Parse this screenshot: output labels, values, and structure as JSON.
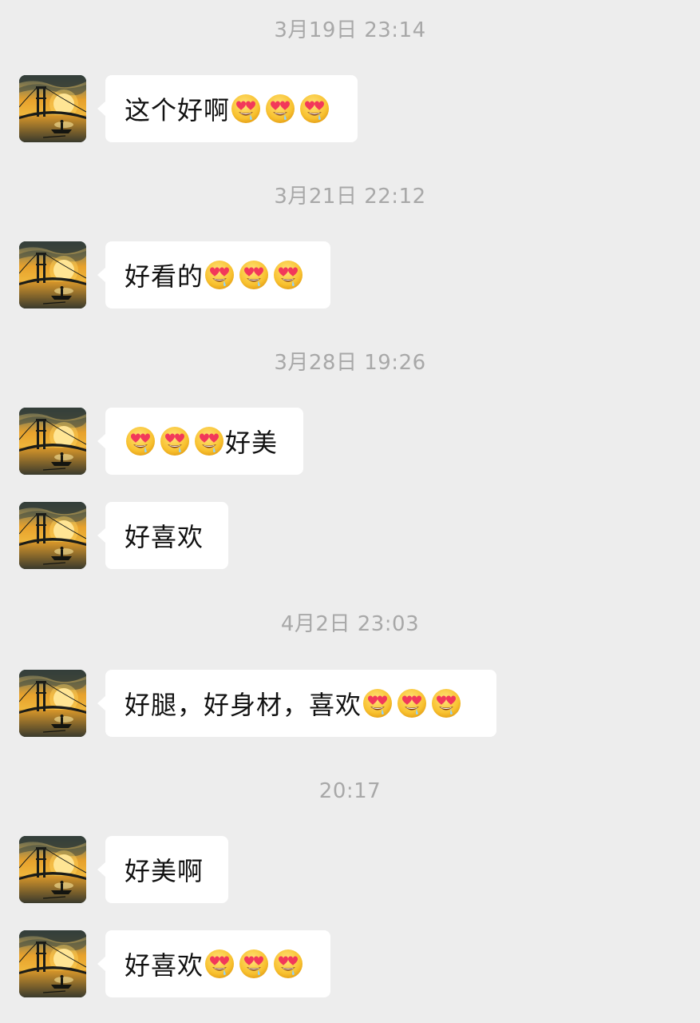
{
  "icons": {
    "avatar": "sunset-bridge-avatar",
    "emoji": "heart-eyes-drooling-emoji"
  },
  "colors": {
    "background": "#ededed",
    "bubble": "#ffffff",
    "timestamp": "#a8a8a8"
  },
  "messages": [
    {
      "timestamp": "3月19日 23:14",
      "text_before": "这个好啊",
      "text_after": "",
      "emoji_before": 0,
      "emoji_after": 3
    },
    {
      "timestamp": "3月21日 22:12",
      "text_before": "好看的",
      "text_after": "",
      "emoji_before": 0,
      "emoji_after": 3
    },
    {
      "timestamp": "3月28日 19:26",
      "text_before": "",
      "text_after": "好美",
      "emoji_before": 3,
      "emoji_after": 0
    },
    {
      "timestamp": "",
      "text_before": "好喜欢",
      "text_after": "",
      "emoji_before": 0,
      "emoji_after": 0
    },
    {
      "timestamp": "4月2日 23:03",
      "text_before": "好腿，好身材，喜欢",
      "text_after": "",
      "emoji_before": 0,
      "emoji_after": 3
    },
    {
      "timestamp": "20:17",
      "text_before": "好美啊",
      "text_after": "",
      "emoji_before": 0,
      "emoji_after": 0
    },
    {
      "timestamp": "",
      "text_before": "好喜欢",
      "text_after": "",
      "emoji_before": 0,
      "emoji_after": 3
    }
  ]
}
